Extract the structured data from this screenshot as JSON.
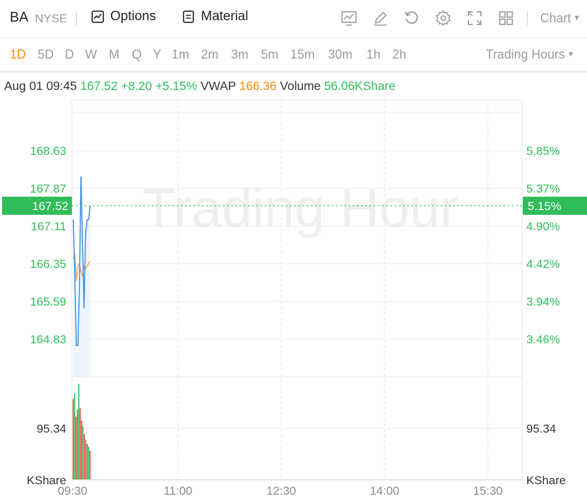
{
  "header": {
    "symbol": "BA",
    "exchange": "NYSE",
    "options_label": "Options",
    "material_label": "Material",
    "chart_label": "Chart"
  },
  "icons": [
    "line-chart-icon",
    "draw-pen-icon",
    "reset-icon",
    "settings-gear-icon",
    "fullscreen-icon",
    "layout-grid-icon"
  ],
  "periods": [
    "1D",
    "5D",
    "D",
    "W",
    "M",
    "Q",
    "Y",
    "1m",
    "2m",
    "3m",
    "5m",
    "15m",
    "30m",
    "1h",
    "2h"
  ],
  "active_period": "1D",
  "trading_hours_label": "Trading Hours",
  "info": {
    "datetime": "Aug 01 09:45",
    "price": "167.52",
    "change": "+8.20",
    "change_pct": "+5.15%",
    "vwap_label": "VWAP",
    "vwap_value": "166.36",
    "volume_label": "Volume",
    "volume_value": "56.06KShare"
  },
  "watermark": "Trading Hour",
  "colors": {
    "up": "#2fbd5a",
    "down": "#e8473f",
    "price_line": "#3a8de0",
    "vwap_line": "#f0a060",
    "accent": "#ff8a00"
  },
  "chart_data": {
    "type": "line",
    "price_ticks": [
      "168.63",
      "167.87",
      "167.11",
      "166.35",
      "165.59",
      "164.83"
    ],
    "pct_ticks": [
      "5.85%",
      "5.37%",
      "4.90%",
      "4.42%",
      "3.94%",
      "3.46%"
    ],
    "current_price_label": "167.52",
    "current_pct_label": "5.15%",
    "time_labels": [
      "09:30",
      "11:00",
      "12:30",
      "14:00",
      "15:30"
    ],
    "ylim": [
      164.2,
      169.3
    ],
    "price_series": [
      [
        0,
        167.24
      ],
      [
        1,
        166.11
      ],
      [
        2,
        164.7
      ],
      [
        3,
        164.7
      ],
      [
        4,
        165.91
      ],
      [
        5,
        168.11
      ],
      [
        6,
        166.8
      ],
      [
        7,
        165.45
      ],
      [
        8,
        166.95
      ],
      [
        9,
        167.24
      ],
      [
        10,
        167.24
      ],
      [
        11,
        167.52
      ]
    ],
    "vwap_series": [
      [
        0,
        166.45
      ],
      [
        1,
        166.55
      ],
      [
        2,
        166.0
      ],
      [
        3,
        166.3
      ],
      [
        4,
        166.35
      ],
      [
        5,
        166.2
      ],
      [
        6,
        166.1
      ],
      [
        7,
        166.3
      ],
      [
        8,
        166.25
      ],
      [
        9,
        166.3
      ],
      [
        10,
        166.36
      ],
      [
        11,
        166.4
      ]
    ],
    "volume_axis_label": "95.34",
    "volume_unit": "KShare",
    "volume_max": 140,
    "volume_bars": [
      {
        "v": 118,
        "dir": "down"
      },
      {
        "v": 126,
        "dir": "up"
      },
      {
        "v": 92,
        "dir": "down"
      },
      {
        "v": 102,
        "dir": "down"
      },
      {
        "v": 140,
        "dir": "up"
      },
      {
        "v": 104,
        "dir": "down"
      },
      {
        "v": 86,
        "dir": "down"
      },
      {
        "v": 78,
        "dir": "up"
      },
      {
        "v": 66,
        "dir": "down"
      },
      {
        "v": 58,
        "dir": "up"
      },
      {
        "v": 52,
        "dir": "down"
      },
      {
        "v": 48,
        "dir": "up"
      },
      {
        "v": 42,
        "dir": "down"
      }
    ]
  }
}
